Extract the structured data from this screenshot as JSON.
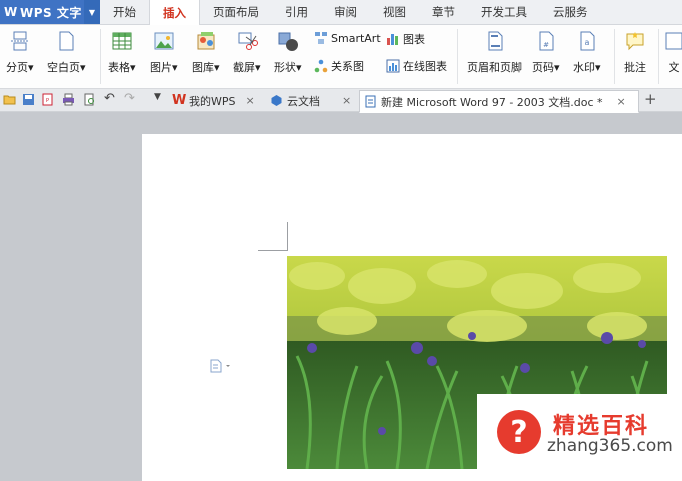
{
  "app": {
    "title": "WPS 文字",
    "logo": "W"
  },
  "menu_tabs": [
    {
      "label": "开始",
      "active": false
    },
    {
      "label": "插入",
      "active": true
    },
    {
      "label": "页面布局",
      "active": false
    },
    {
      "label": "引用",
      "active": false
    },
    {
      "label": "审阅",
      "active": false
    },
    {
      "label": "视图",
      "active": false
    },
    {
      "label": "章节",
      "active": false
    },
    {
      "label": "开发工具",
      "active": false
    },
    {
      "label": "云服务",
      "active": false
    }
  ],
  "ribbon": {
    "page_break": "分页",
    "blank_page": "空白页",
    "table": "表格",
    "picture": "图片",
    "gallery": "图库",
    "screenshot": "截屏",
    "shapes": "形状",
    "smartart": "SmartArt",
    "chart": "图表",
    "relation": "关系图",
    "online_chart": "在线图表",
    "header_footer": "页眉和页脚",
    "page_number": "页码",
    "watermark": "水印",
    "comment": "批注",
    "textbox": "文"
  },
  "doc_tabs": {
    "tab1": "我的WPS",
    "tab2": "云文档",
    "tab3": "新建 Microsoft Word 97 - 2003 文档.doc *",
    "close": "×",
    "new_tab": "+"
  },
  "watermark_logo": {
    "cn": "精选百科",
    "url": "zhang365.com",
    "mark": "?"
  },
  "colors": {
    "accent": "#3f73c4",
    "active_tab_text": "#d1331f",
    "workspace": "#c6c9ce",
    "logo_red": "#e63b2e"
  }
}
